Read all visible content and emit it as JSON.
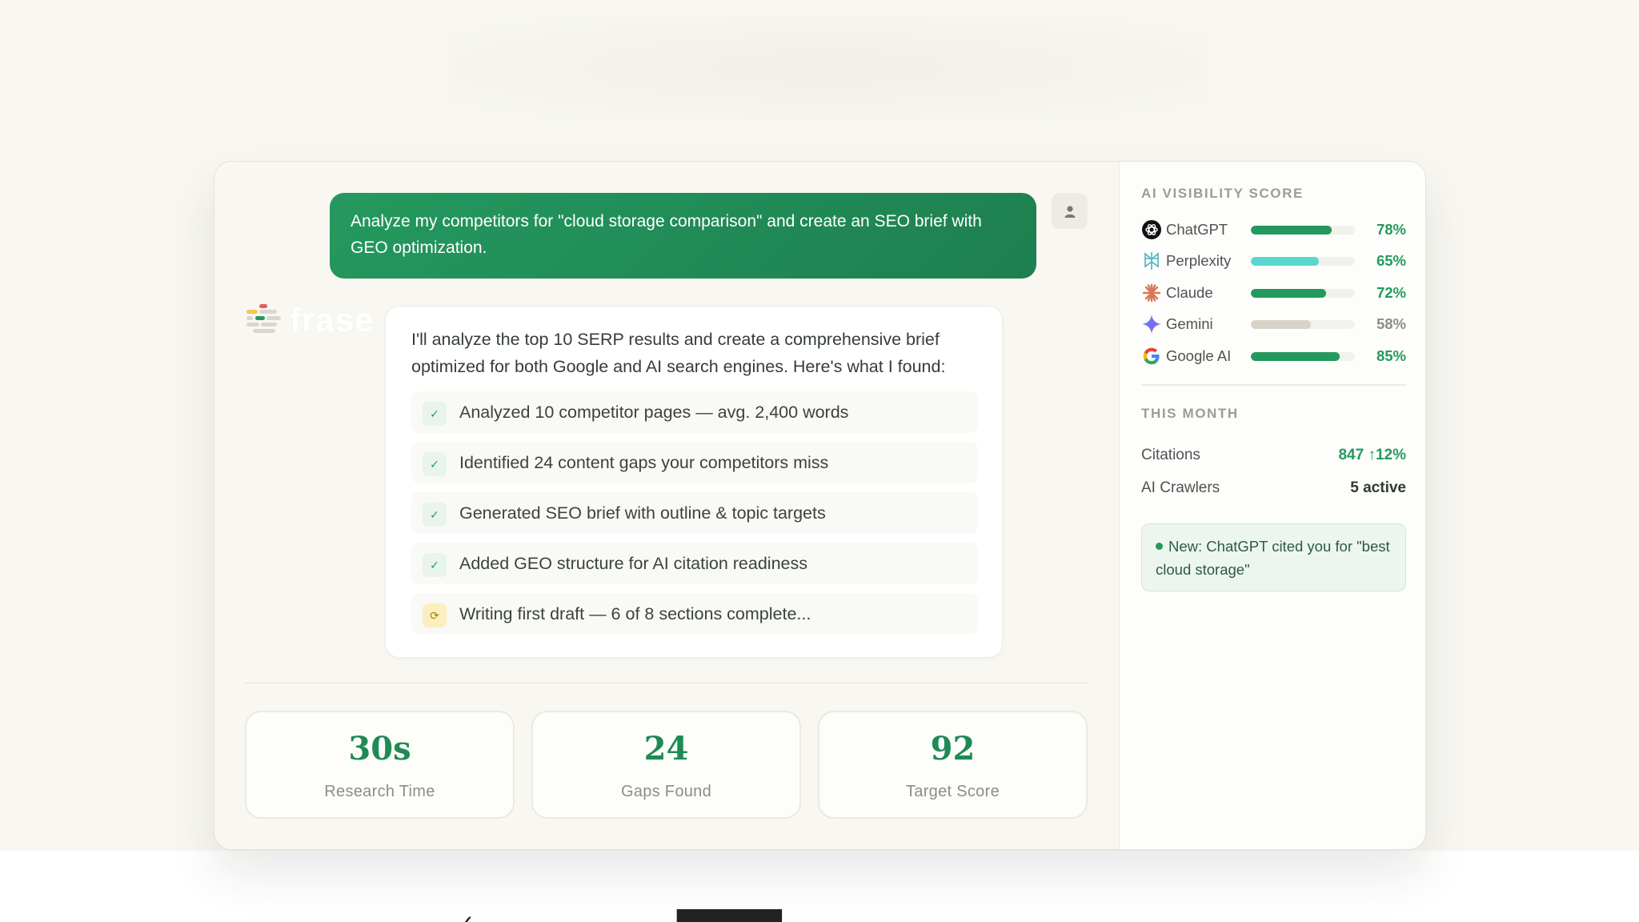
{
  "chat": {
    "user_message": "Analyze my competitors for \"cloud storage comparison\" and create an SEO brief with GEO optimization.",
    "brand": {
      "name": "frase"
    },
    "assistant_intro": "I'll analyze the top 10 SERP results and create a comprehensive brief optimized for both Google and AI search engines. Here's what I found:",
    "steps": [
      {
        "text": "Analyzed 10 competitor pages — avg. 2,400 words",
        "status": "done",
        "icon": "✓"
      },
      {
        "text": "Identified 24 content gaps your competitors miss",
        "status": "done",
        "icon": "✓"
      },
      {
        "text": "Generated SEO brief with outline & topic targets",
        "status": "done",
        "icon": "✓"
      },
      {
        "text": "Added GEO structure for AI citation readiness",
        "status": "done",
        "icon": "✓"
      },
      {
        "text": "Writing first draft — 6 of 8 sections complete...",
        "status": "in-progress",
        "icon": "⟳"
      }
    ]
  },
  "stats": [
    {
      "value": "30s",
      "label": "Research Time"
    },
    {
      "value": "24",
      "label": "Gaps Found"
    },
    {
      "value": "92",
      "label": "Target Score"
    }
  ],
  "sidebar": {
    "visibility_title": "AI VISIBILITY SCORE",
    "engines": [
      {
        "name": "ChatGPT",
        "pct_label": "78%",
        "value": 0.78,
        "bar_color": "#24995e",
        "pct_color": "#24995e",
        "icon": "chatgpt-icon"
      },
      {
        "name": "Perplexity",
        "pct_label": "65%",
        "value": 0.65,
        "bar_color": "#5ad8cf",
        "pct_color": "#24995e",
        "icon": "perplexity-icon"
      },
      {
        "name": "Claude",
        "pct_label": "72%",
        "value": 0.72,
        "bar_color": "#24995e",
        "pct_color": "#24995e",
        "icon": "claude-icon"
      },
      {
        "name": "Gemini",
        "pct_label": "58%",
        "value": 0.58,
        "bar_color": "#d8d3c6",
        "pct_color": "#8a8e88",
        "icon": "gemini-icon"
      },
      {
        "name": "Google AI",
        "pct_label": "85%",
        "value": 0.85,
        "bar_color": "#24995e",
        "pct_color": "#24995e",
        "icon": "google-icon"
      }
    ],
    "month_title": "THIS MONTH",
    "citations": {
      "label": "Citations",
      "value": "847 ↑12%",
      "color": "#24995e"
    },
    "crawlers": {
      "label": "AI Crawlers",
      "value": "5 active"
    },
    "notice": "New: ChatGPT cited you for \"best cloud storage\""
  },
  "colors": {
    "accent": "#24995e",
    "accent_dark": "#1e7f4f",
    "background": "#f8f7f2"
  }
}
